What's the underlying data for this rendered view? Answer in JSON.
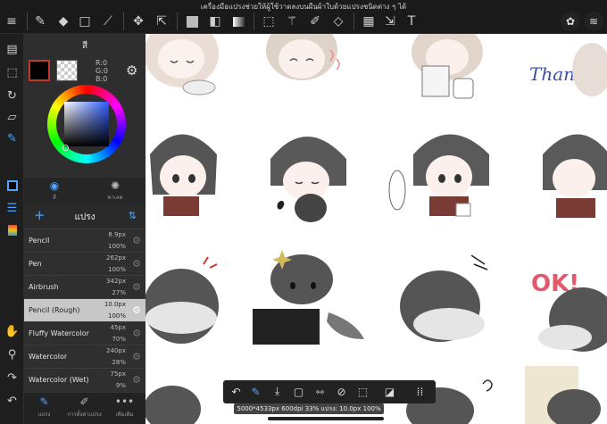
{
  "top_hint": "เครื่องมือแปรงช่วยให้ผู้ใช้วาดลงบนผืนผ้าใบด้วยแปรงชนิดต่าง ๆ ได้",
  "color_panel": {
    "title": "สี",
    "r": "R:0",
    "g": "G:0",
    "b": "B:0",
    "tabs": [
      {
        "icon": "circle-icon",
        "label": "สี"
      },
      {
        "icon": "palette-icon",
        "label": "พาเลต"
      }
    ]
  },
  "brush_panel": {
    "title": "แปรง",
    "brushes": [
      {
        "name": "Pencil",
        "size": "8.9px",
        "opacity": "100%",
        "selected": false
      },
      {
        "name": "Pen",
        "size": "262px",
        "opacity": "100%",
        "selected": false
      },
      {
        "name": "Airbrush",
        "size": "342px",
        "opacity": "27%",
        "selected": false
      },
      {
        "name": "Pencil (Rough)",
        "size": "10.0px",
        "opacity": "100%",
        "selected": true
      },
      {
        "name": "Fluffy Watercolor",
        "size": "45px",
        "opacity": "70%",
        "selected": false
      },
      {
        "name": "Watercolor",
        "size": "240px",
        "opacity": "28%",
        "selected": false
      },
      {
        "name": "Watercolor (Wet)",
        "size": "75px",
        "opacity": "9%",
        "selected": false
      }
    ]
  },
  "bottom_tabs": [
    {
      "icon": "brush-icon",
      "label": "แปรง"
    },
    {
      "icon": "brush-settings-icon",
      "label": "การตั้งค่าแปรง"
    },
    {
      "icon": "more-icon",
      "label": "เพิ่มเติม"
    }
  ],
  "canvas": {
    "text_thank_you": "Thank you.",
    "text_ok": "OK!"
  },
  "status_bar": "5000*4533px 600dpi 33% แปรง: 10.0px 100%",
  "colors": {
    "accent": "#4ea3ff",
    "primary_color": "#000000",
    "primary_border": "#c0392b",
    "selected_row": "#c8c8c8"
  }
}
